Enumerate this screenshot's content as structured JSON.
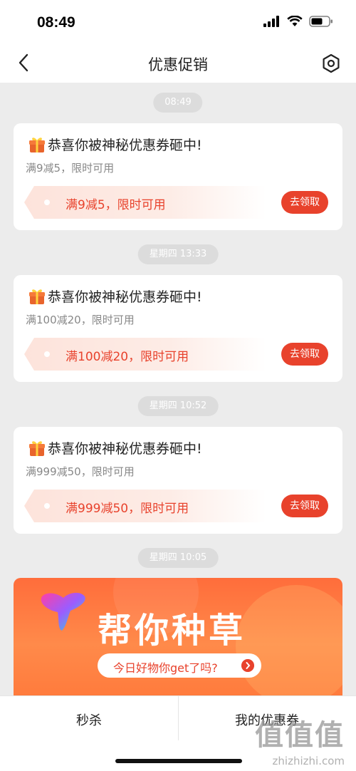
{
  "status": {
    "time": "08:49"
  },
  "nav": {
    "title": "优惠促销"
  },
  "messages": [
    {
      "time": "08:49",
      "title": "恭喜你被神秘优惠券砸中!",
      "subtitle": "满9减5，限时可用",
      "coupon": "满9减5，限时可用",
      "button": "去领取"
    },
    {
      "time": "星期四 13:33",
      "title": "恭喜你被神秘优惠券砸中!",
      "subtitle": "满100减20，限时可用",
      "coupon": "满100减20，限时可用",
      "button": "去领取"
    },
    {
      "time": "星期四 10:52",
      "title": "恭喜你被神秘优惠券砸中!",
      "subtitle": "满999减50，限时可用",
      "coupon": "满999减50，限时可用",
      "button": "去领取"
    },
    {
      "time": "星期四 10:05"
    }
  ],
  "banner": {
    "title": "帮你种草",
    "pill": "今日好物你get了吗?"
  },
  "tabs": [
    {
      "label": "秒杀"
    },
    {
      "label": "我的优惠券"
    }
  ],
  "watermark": {
    "glyphs": "值值值",
    "url": "zhizhizhi.com"
  },
  "colors": {
    "accent": "#e8422c",
    "banner": "#ff7a3c",
    "background": "#ececec"
  },
  "icons": {
    "back": "chevron-left-icon",
    "settings": "hexagon-gear-icon",
    "gift": "gift-box-icon"
  }
}
